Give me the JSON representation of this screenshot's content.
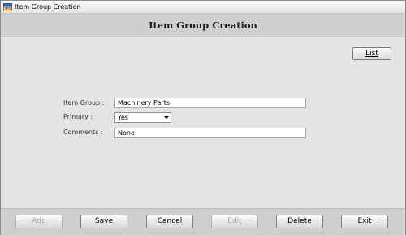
{
  "window": {
    "title": "Item Group Creation"
  },
  "header": {
    "title": "Item Group Creation"
  },
  "toolbar": {
    "list_label": "List"
  },
  "form": {
    "item_group": {
      "label": "Item Group :",
      "value": "Machinery Parts"
    },
    "primary": {
      "label": "Primary :",
      "selected": "Yes"
    },
    "comments": {
      "label": "Comments :",
      "value": "None"
    }
  },
  "actions": {
    "add": "Add",
    "save": "Save",
    "cancel": "Cancel",
    "edit": "Edit",
    "delete": "Delete",
    "exit": "Exit"
  },
  "icons": {
    "app": "app-window-icon",
    "dropdown": "chevron-down-icon"
  },
  "colors": {
    "window_background": "#e4e4e4",
    "header_background": "#cfcfcf",
    "disabled_text": "#a3a3a3"
  }
}
